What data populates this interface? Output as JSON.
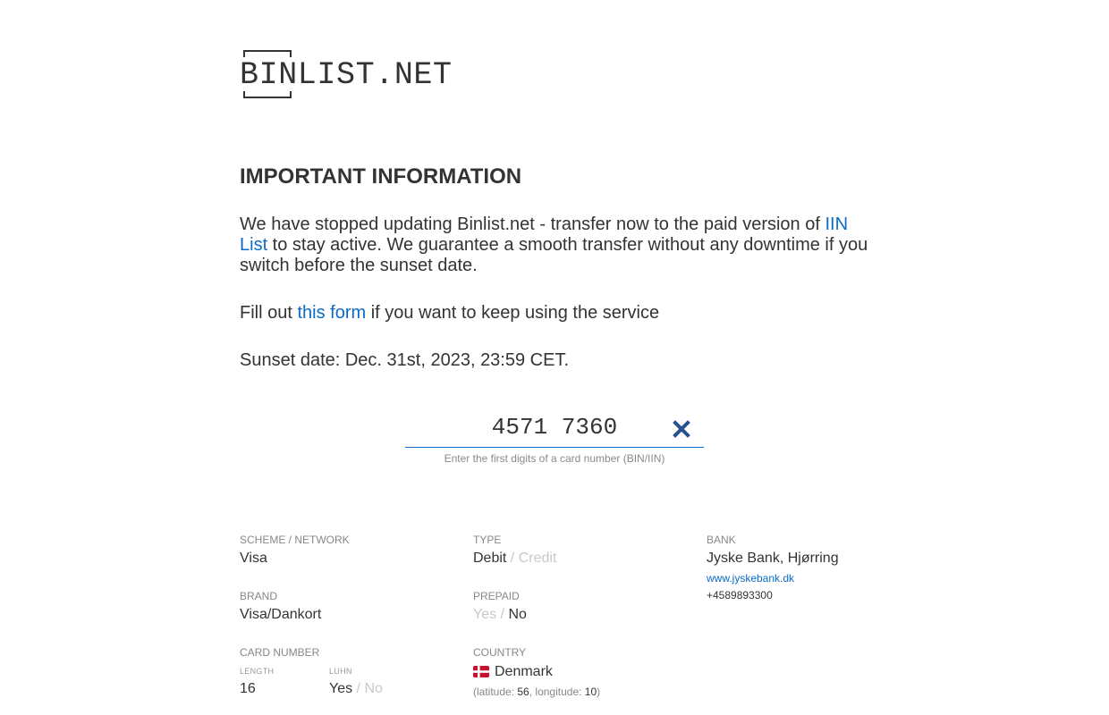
{
  "logo": {
    "text": "BINLIST.NET"
  },
  "notice": {
    "heading": "IMPORTANT INFORMATION",
    "p1_before": "We have stopped updating Binlist.net - transfer now to the paid version of ",
    "p1_link": "IIN List",
    "p1_after": " to stay active. We guarantee a smooth transfer without any downtime if you switch before the sunset date.",
    "p2_before": "Fill out ",
    "p2_link": "this form",
    "p2_after": " if you want to keep using the service",
    "p3": "Sunset date: Dec. 31st, 2023, 23:59 CET."
  },
  "search": {
    "value": "4571 7360",
    "hint": "Enter the first digits of a card number (BIN/IIN)",
    "clear_icon": "close-icon"
  },
  "result": {
    "scheme": {
      "label": "SCHEME / NETWORK",
      "value": "Visa"
    },
    "brand": {
      "label": "BRAND",
      "value": "Visa/Dankort"
    },
    "card_number": {
      "label": "CARD NUMBER",
      "length_label": "LENGTH",
      "length": "16",
      "luhn_label": "LUHN",
      "luhn_yes": "Yes",
      "luhn_sep": " / ",
      "luhn_no": "No"
    },
    "type": {
      "label": "TYPE",
      "debit": "Debit",
      "sep": " / ",
      "credit": "Credit"
    },
    "prepaid": {
      "label": "PREPAID",
      "yes": "Yes",
      "sep": " / ",
      "no": "No"
    },
    "country": {
      "label": "COUNTRY",
      "name": "Denmark",
      "lat_label": "latitude:",
      "lat": "56",
      "lon_label": ", longitude:",
      "lon": "10",
      "flag_icon": "denmark-flag-icon"
    },
    "bank": {
      "label": "BANK",
      "name": "Jyske Bank, Hjørring",
      "url": "www.jyskebank.dk",
      "phone": "+4589893300"
    }
  },
  "colors": {
    "accent": "#0a6bc8",
    "text": "#333333",
    "muted": "#c8c8c8",
    "clear_icon": "#2a4f8f"
  }
}
